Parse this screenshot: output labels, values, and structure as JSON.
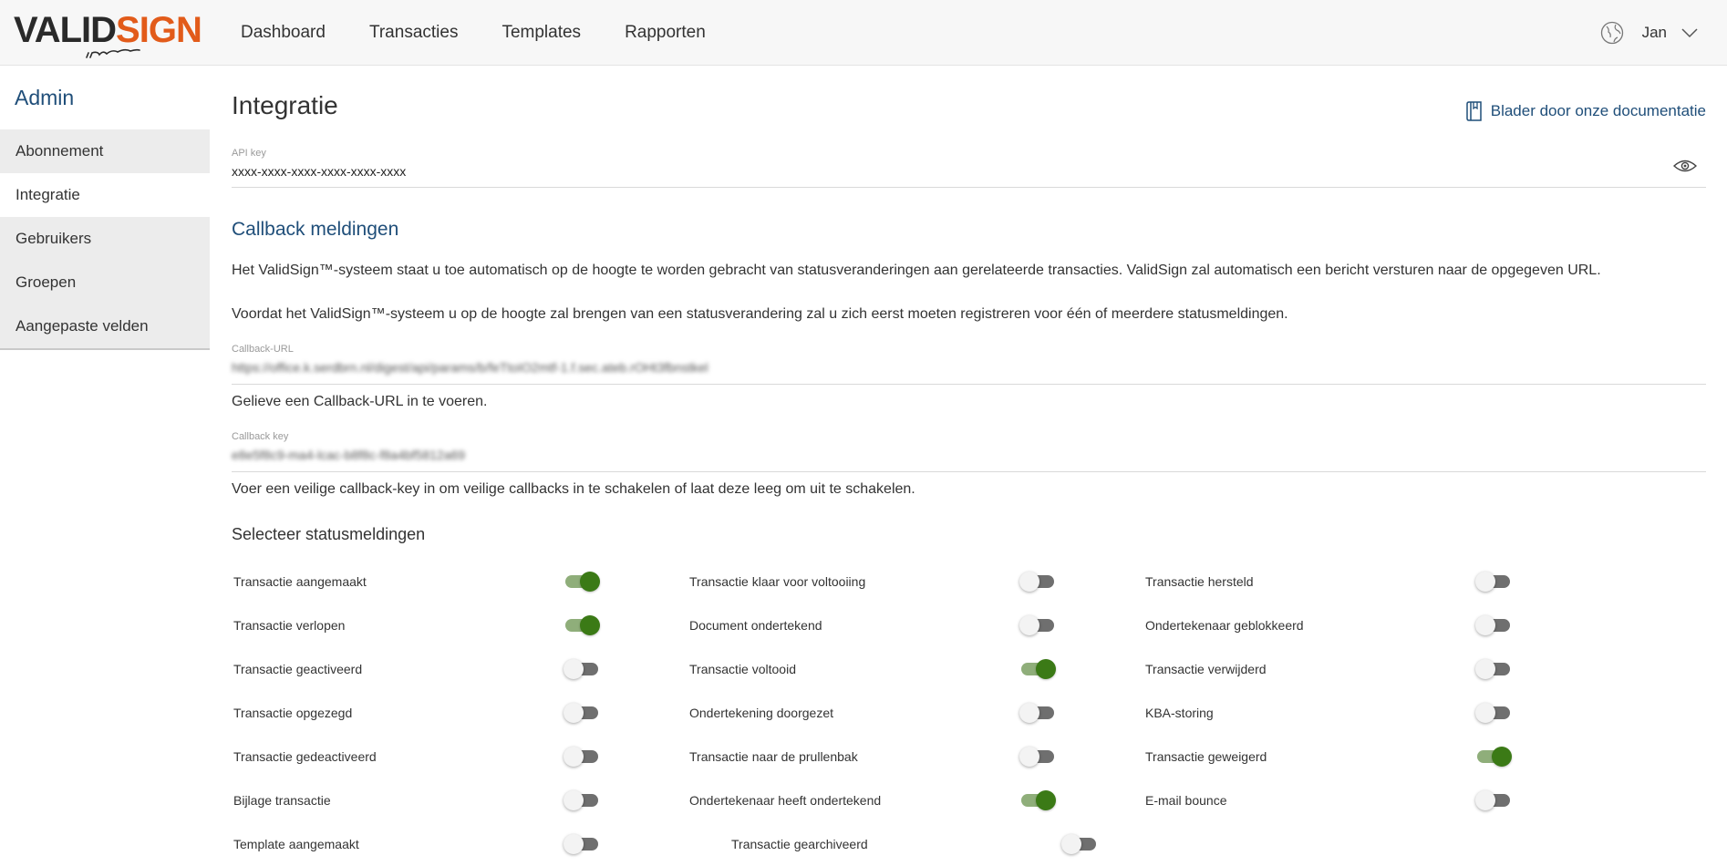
{
  "logo": {
    "part1": "VALID",
    "part2": "SIGN"
  },
  "nav": [
    "Dashboard",
    "Transacties",
    "Templates",
    "Rapporten"
  ],
  "user": {
    "name": "Jan"
  },
  "sidebar": {
    "title": "Admin",
    "items": [
      "Abonnement",
      "Integratie",
      "Gebruikers",
      "Groepen",
      "Aangepaste velden"
    ],
    "active": "Integratie"
  },
  "main": {
    "title": "Integratie",
    "doc_link": "Blader door onze documentatie",
    "api_key": {
      "label": "API key",
      "value": "xxxx-xxxx-xxxx-xxxx-xxxx-xxxx"
    },
    "callback_title": "Callback meldingen",
    "para1": "Het ValidSign™-systeem staat u toe automatisch op de hoogte te worden gebracht van statusveranderingen aan gerelateerde transacties. ValidSign zal automatisch een bericht versturen naar de opgegeven URL.",
    "para2": "Voordat het ValidSign™-systeem u op de hoogte zal brengen van een statusverandering zal u zich eerst moeten registreren voor één of meerdere statusmeldingen.",
    "callback_url": {
      "label": "Callback-URL",
      "value": "https://office.k.serdbrn.nl/digest/api/params/b/feTtoIO2mtf-1.f.sec.ateb.rOHt3fbnstkel",
      "hint": "Gelieve een Callback-URL in te voeren."
    },
    "callback_key": {
      "label": "Callback key",
      "value": "e8e5f8c9-ma4-lcac-b8f8c-f8a4bf5812a69",
      "hint": "Voer een veilige callback-key in om veilige callbacks in te schakelen of laat deze leeg om uit te schakelen."
    },
    "status_title": "Selecteer statusmeldingen"
  },
  "toggles": [
    [
      {
        "label": "Transactie aangemaakt",
        "on": true
      },
      {
        "label": "Transactie klaar voor voltooiing",
        "on": false
      },
      {
        "label": "Transactie hersteld",
        "on": false
      }
    ],
    [
      {
        "label": "Transactie verlopen",
        "on": true
      },
      {
        "label": "Document ondertekend",
        "on": false
      },
      {
        "label": "Ondertekenaar geblokkeerd",
        "on": false
      }
    ],
    [
      {
        "label": "Transactie geactiveerd",
        "on": false
      },
      {
        "label": "Transactie voltooid",
        "on": true
      },
      {
        "label": "Transactie verwijderd",
        "on": false
      }
    ],
    [
      {
        "label": "Transactie opgezegd",
        "on": false
      },
      {
        "label": "Ondertekening doorgezet",
        "on": false
      },
      {
        "label": "KBA-storing",
        "on": false
      }
    ],
    [
      {
        "label": "Transactie gedeactiveerd",
        "on": false
      },
      {
        "label": "Transactie naar de prullenbak",
        "on": false
      },
      {
        "label": "Transactie geweigerd",
        "on": true
      }
    ],
    [
      {
        "label": "Bijlage transactie",
        "on": false
      },
      {
        "label": "Ondertekenaar heeft ondertekend",
        "on": true
      },
      {
        "label": "E-mail bounce",
        "on": false
      }
    ],
    [
      {
        "label": "Template aangemaakt",
        "on": false
      },
      {
        "label": "Transactie gearchiveerd",
        "on": false
      }
    ]
  ],
  "colors": {
    "brand_orange": "#e25b1a",
    "link_blue": "#1f4e79",
    "toggle_on": "#3b7a16"
  },
  "icons": {
    "globe": "globe-icon",
    "chevron": "chevron-down-icon",
    "doc": "book-icon",
    "eye": "eye-icon"
  }
}
